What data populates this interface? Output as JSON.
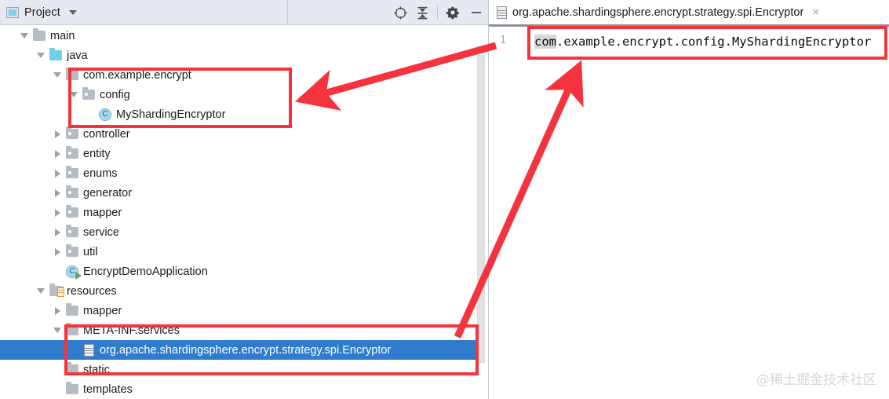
{
  "window": {
    "panel_title": "Project"
  },
  "toolbar": {
    "locate_icon": "crosshair-target-icon",
    "collapse_icon": "collapse-all-icon",
    "settings_icon": "gear-icon",
    "minimize_icon": "minimize-icon",
    "dropdown_icon": "chevron-down-icon"
  },
  "tree": {
    "rows": [
      {
        "label": "main",
        "indent": 1,
        "toggle": "down",
        "icon": "folder"
      },
      {
        "label": "java",
        "indent": 2,
        "toggle": "down",
        "icon": "folder-blue"
      },
      {
        "label": "com.example.encrypt",
        "indent": 3,
        "toggle": "down",
        "icon": "package"
      },
      {
        "label": "config",
        "indent": 4,
        "toggle": "down",
        "icon": "package"
      },
      {
        "label": "MyShardingEncryptor",
        "indent": 5,
        "toggle": "none",
        "icon": "class"
      },
      {
        "label": "controller",
        "indent": 3,
        "toggle": "right",
        "icon": "package"
      },
      {
        "label": "entity",
        "indent": 3,
        "toggle": "right",
        "icon": "package"
      },
      {
        "label": "enums",
        "indent": 3,
        "toggle": "right",
        "icon": "package"
      },
      {
        "label": "generator",
        "indent": 3,
        "toggle": "right",
        "icon": "package"
      },
      {
        "label": "mapper",
        "indent": 3,
        "toggle": "right",
        "icon": "package"
      },
      {
        "label": "service",
        "indent": 3,
        "toggle": "right",
        "icon": "package"
      },
      {
        "label": "util",
        "indent": 3,
        "toggle": "right",
        "icon": "package"
      },
      {
        "label": "EncryptDemoApplication",
        "indent": 3,
        "toggle": "none",
        "icon": "class-runnable"
      },
      {
        "label": "resources",
        "indent": 2,
        "toggle": "down",
        "icon": "folder-resources"
      },
      {
        "label": "mapper",
        "indent": 3,
        "toggle": "right",
        "icon": "folder"
      },
      {
        "label": "META-INF.services",
        "indent": 3,
        "toggle": "down",
        "icon": "folder"
      },
      {
        "label": "org.apache.shardingsphere.encrypt.strategy.spi.Encryptor",
        "indent": 4,
        "toggle": "none",
        "icon": "file",
        "selected": true
      },
      {
        "label": "static",
        "indent": 3,
        "toggle": "none",
        "icon": "folder"
      },
      {
        "label": "templates",
        "indent": 3,
        "toggle": "none",
        "icon": "folder"
      }
    ]
  },
  "editor": {
    "tab_label": "org.apache.shardingsphere.encrypt.strategy.spi.Encryptor",
    "tab_icon": "file-icon",
    "close_label": "×",
    "line_number": "1",
    "code_selected": "com",
    "code_rest": ".example.encrypt.config.MyShardingEncryptor"
  },
  "annotations": {
    "accent_color": "#f5333f",
    "selection_color": "#2f7ccd"
  },
  "watermark": {
    "text": "@稀土掘金技术社区"
  }
}
